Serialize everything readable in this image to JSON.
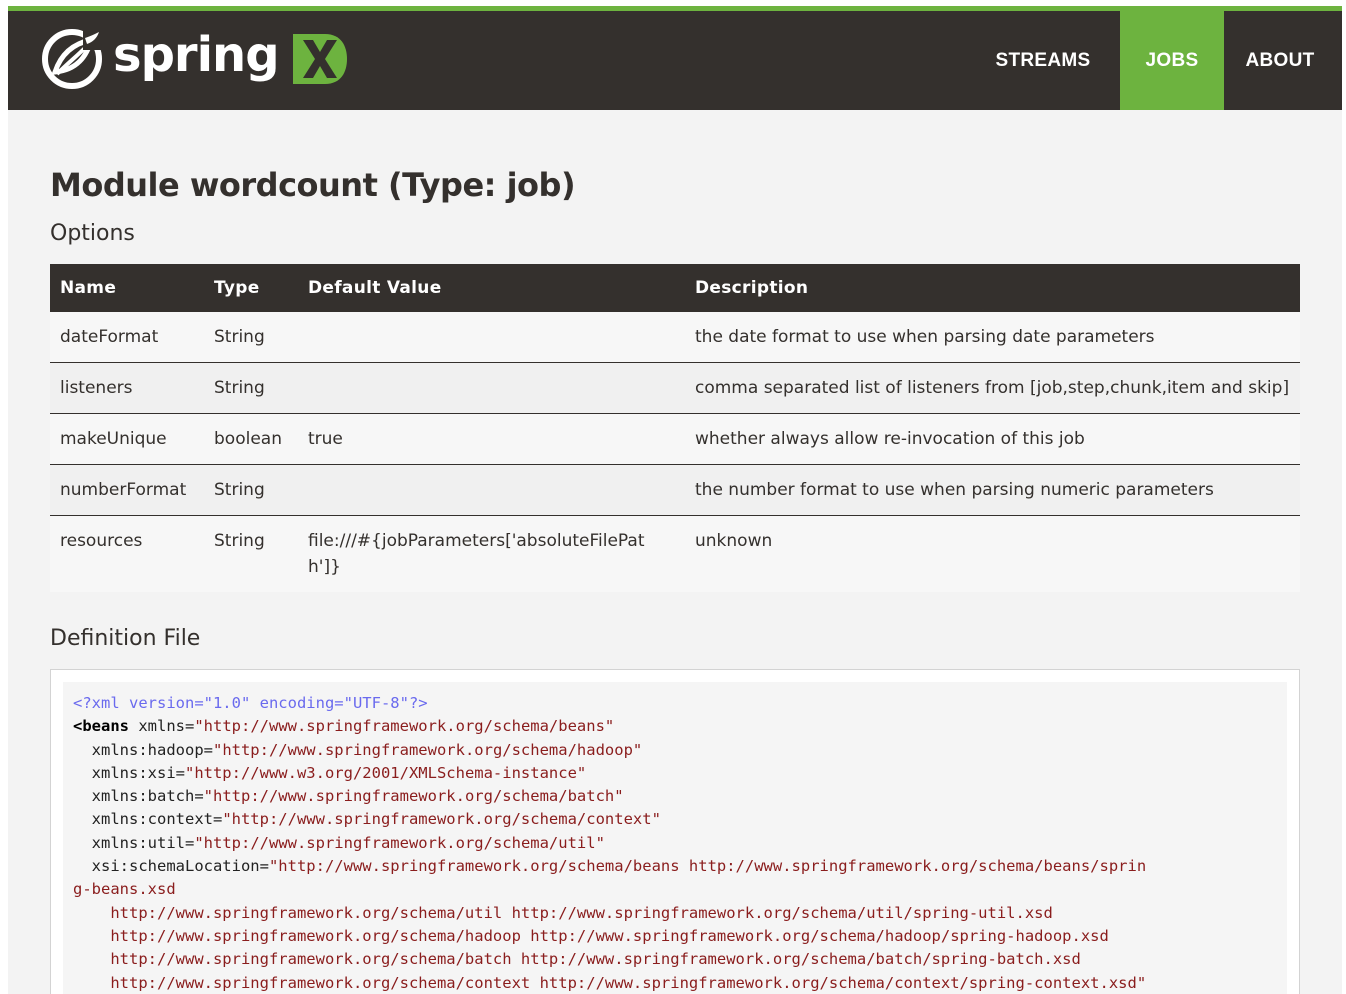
{
  "brand": {
    "name": "spring",
    "accent": "#6db33f",
    "dark": "#34302d",
    "logo_icon": "spring-leaf-icon",
    "x_icon": "spring-x-icon"
  },
  "nav": {
    "streams": "STREAMS",
    "jobs": "JOBS",
    "about": "ABOUT",
    "active": "JOBS"
  },
  "page": {
    "title": "Module wordcount (Type: job)",
    "options_title": "Options",
    "definition_title": "Definition File"
  },
  "table": {
    "headers": [
      "Name",
      "Type",
      "Default Value",
      "Description"
    ],
    "rows": [
      {
        "name": "dateFormat",
        "type": "String",
        "default_value": "",
        "description": "the date format to use when parsing date parameters"
      },
      {
        "name": "listeners",
        "type": "String",
        "default_value": "",
        "description": "comma separated list of listeners from [job,step,chunk,item and skip]"
      },
      {
        "name": "makeUnique",
        "type": "boolean",
        "default_value": "true",
        "description": "whether always allow re-invocation of this job"
      },
      {
        "name": "numberFormat",
        "type": "String",
        "default_value": "",
        "description": "the number format to use when parsing numeric parameters"
      },
      {
        "name": "resources",
        "type": "String",
        "default_value": "file:///#{jobParameters['absoluteFilePath']}",
        "description": "unknown"
      }
    ]
  },
  "code": {
    "xml_decl": "<?xml version=\"1.0\" encoding=\"UTF-8\"?>",
    "lines": [
      {
        "tag": "<beans",
        "attr": " xmlns=",
        "str": "\"http://www.springframework.org/schema/beans\""
      },
      {
        "attr": "  xmlns:hadoop=",
        "str": "\"http://www.springframework.org/schema/hadoop\""
      },
      {
        "attr": "  xmlns:xsi=",
        "str": "\"http://www.w3.org/2001/XMLSchema-instance\""
      },
      {
        "attr": "  xmlns:batch=",
        "str": "\"http://www.springframework.org/schema/batch\""
      },
      {
        "attr": "  xmlns:context=",
        "str": "\"http://www.springframework.org/schema/context\""
      },
      {
        "attr": "  xmlns:util=",
        "str": "\"http://www.springframework.org/schema/util\""
      },
      {
        "attr": "  xsi:schemaLocation=",
        "str": "\"http://www.springframework.org/schema/beans http://www.springframework.org/schema/beans/sprin"
      },
      {
        "str": "g-beans.xsd"
      },
      {
        "str": "    http://www.springframework.org/schema/util http://www.springframework.org/schema/util/spring-util.xsd"
      },
      {
        "str": "    http://www.springframework.org/schema/hadoop http://www.springframework.org/schema/hadoop/spring-hadoop.xsd"
      },
      {
        "str": "    http://www.springframework.org/schema/batch http://www.springframework.org/schema/batch/spring-batch.xsd"
      },
      {
        "str": "    http://www.springframework.org/schema/context http://www.springframework.org/schema/context/spring-context.xsd\""
      }
    ]
  }
}
